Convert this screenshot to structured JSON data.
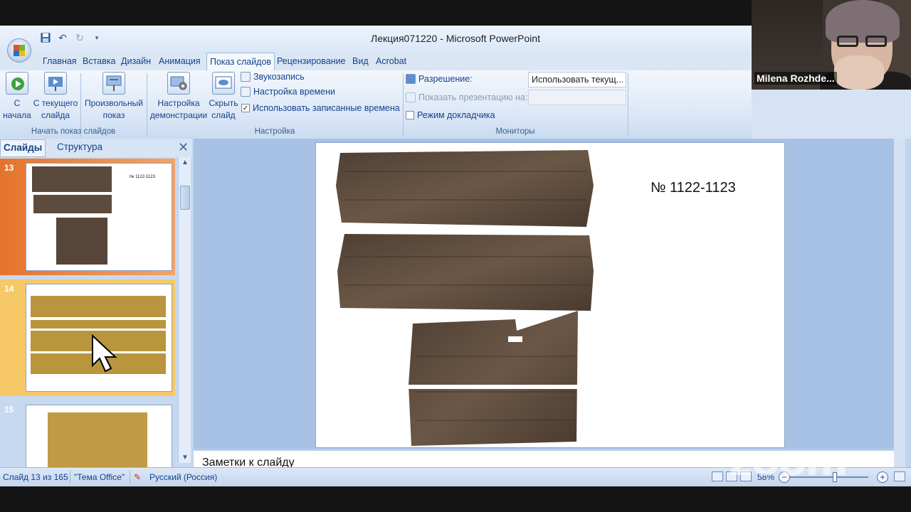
{
  "window": {
    "title": "Лекция071220 - Microsoft PowerPoint"
  },
  "ribbon_tabs": [
    "Главная",
    "Вставка",
    "Дизайн",
    "Анимация",
    "Показ слайдов",
    "Рецензирование",
    "Вид",
    "Acrobat"
  ],
  "ribbon": {
    "start_group": {
      "label": "Начать показ слайдов",
      "from_start": "С\nначала",
      "from_current": "С текущего\nслайда",
      "custom": "Произвольный\nпоказ"
    },
    "setup_group": {
      "label": "Настройка",
      "setup_show": "Настройка\nдемонстрации",
      "hide_slide": "Скрыть\nслайд",
      "record_narration": "Звукозапись",
      "rehearse_timings": "Настройка времени",
      "use_timings": "Использовать записанные времена",
      "use_timings_checked": true
    },
    "monitors_group": {
      "label": "Мониторы",
      "resolution_label": "Разрешение:",
      "resolution_value": "Использовать текущ...",
      "show_on_label": "Показать презентацию на:",
      "presenter_view": "Режим докладчика",
      "presenter_view_checked": false
    }
  },
  "slides_panel": {
    "tab_slides": "Слайды",
    "tab_outline": "Структура",
    "thumbnails": [
      {
        "number": "13",
        "caption": "№ 1122-1123",
        "selected": true
      },
      {
        "number": "14",
        "caption": "",
        "selected": false
      },
      {
        "number": "15",
        "caption": "",
        "selected": false
      }
    ]
  },
  "slide": {
    "title": "№ 1122-1123"
  },
  "notes": {
    "placeholder": "Заметки к слайду"
  },
  "status_bar": {
    "slide_position": "Слайд 13 из 165",
    "theme": "\"Тема Office\"",
    "language": "Русский (Россия)",
    "zoom": "58%"
  },
  "webcam": {
    "name": "Milena Rozhde..."
  },
  "watermark": "zoom"
}
